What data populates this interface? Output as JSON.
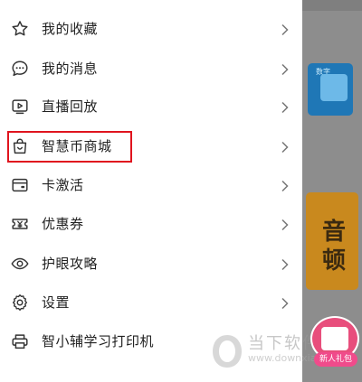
{
  "menu": {
    "items": [
      {
        "label": "我的收藏",
        "icon": "star-icon"
      },
      {
        "label": "我的消息",
        "icon": "message-icon"
      },
      {
        "label": "直播回放",
        "icon": "play-icon"
      },
      {
        "label": "智慧币商城",
        "icon": "shopping-bag-icon"
      },
      {
        "label": "卡激活",
        "icon": "card-icon"
      },
      {
        "label": "优惠券",
        "icon": "coupon-icon"
      },
      {
        "label": "护眼攻略",
        "icon": "eye-icon"
      },
      {
        "label": "设置",
        "icon": "gear-icon"
      },
      {
        "label": "智小辅学习打印机",
        "icon": "printer-icon"
      }
    ],
    "highlighted_item": "智慧币商城",
    "highlight_color": "#e0141e"
  },
  "background": {
    "card_blue_tag": "数字",
    "card_orange_glyph": "音\n顿"
  },
  "gift": {
    "label": "新人礼包"
  },
  "watermark": {
    "text": "当下软件园",
    "sub": "www.downxia.com"
  }
}
